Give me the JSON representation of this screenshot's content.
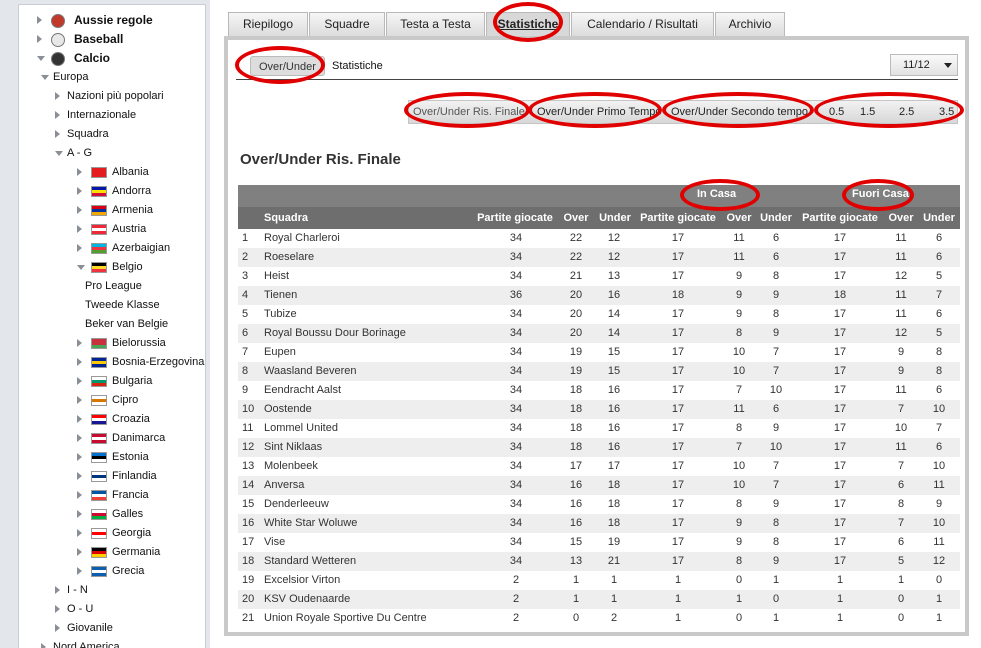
{
  "sidebar": {
    "items": [
      {
        "label": "Aussie regole",
        "kind": "sport",
        "icon": "rugby-ball-icon",
        "level": 0
      },
      {
        "label": "Baseball",
        "kind": "sport",
        "icon": "baseball-icon",
        "level": 0
      },
      {
        "label": "Calcio",
        "kind": "sport",
        "icon": "soccer-ball-icon",
        "level": 0,
        "expanded": true
      },
      {
        "label": "Europa",
        "level": 1,
        "expanded": true
      },
      {
        "label": "Nazioni più popolari",
        "level": 2
      },
      {
        "label": "Internazionale",
        "level": 2
      },
      {
        "label": "Squadra",
        "level": 2
      },
      {
        "label": "A - G",
        "level": 2,
        "expanded": true
      },
      {
        "label": "Albania",
        "level": 3,
        "flag": [
          "#e41e20",
          "#e41e20",
          "#e41e20"
        ]
      },
      {
        "label": "Andorra",
        "level": 3,
        "flag": [
          "#0018a8",
          "#fedf00",
          "#d0103a"
        ]
      },
      {
        "label": "Armenia",
        "level": 3,
        "flag": [
          "#d90012",
          "#0033a0",
          "#f2a800"
        ]
      },
      {
        "label": "Austria",
        "level": 3,
        "flag": [
          "#ed2939",
          "#ffffff",
          "#ed2939"
        ]
      },
      {
        "label": "Azerbaigian",
        "level": 3,
        "flag": [
          "#00b5e2",
          "#ef3340",
          "#509e2f"
        ]
      },
      {
        "label": "Belgio",
        "level": 3,
        "expanded": true,
        "flag": [
          "#000000",
          "#fdda24",
          "#ef3340"
        ]
      },
      {
        "label": "Pro League",
        "level": 4
      },
      {
        "label": "Tweede Klasse",
        "level": 4
      },
      {
        "label": "Beker van Belgie",
        "level": 4
      },
      {
        "label": "Bielorussia",
        "level": 3,
        "flag": [
          "#c8313e",
          "#c8313e",
          "#4aa657"
        ]
      },
      {
        "label": "Bosnia-Erzegovina",
        "level": 3,
        "flag": [
          "#002395",
          "#fecb00",
          "#002395"
        ]
      },
      {
        "label": "Bulgaria",
        "level": 3,
        "flag": [
          "#ffffff",
          "#00966e",
          "#d62612"
        ]
      },
      {
        "label": "Cipro",
        "level": 3,
        "flag": [
          "#ffffff",
          "#d57800",
          "#ffffff"
        ]
      },
      {
        "label": "Croazia",
        "level": 3,
        "flag": [
          "#ff0000",
          "#ffffff",
          "#171796"
        ]
      },
      {
        "label": "Danimarca",
        "level": 3,
        "flag": [
          "#c60c30",
          "#ffffff",
          "#c60c30"
        ]
      },
      {
        "label": "Estonia",
        "level": 3,
        "flag": [
          "#0072ce",
          "#000000",
          "#ffffff"
        ]
      },
      {
        "label": "Finlandia",
        "level": 3,
        "flag": [
          "#ffffff",
          "#003580",
          "#ffffff"
        ]
      },
      {
        "label": "Francia",
        "level": 3,
        "flag": [
          "#0055a4",
          "#ffffff",
          "#ef4135"
        ]
      },
      {
        "label": "Galles",
        "level": 3,
        "flag": [
          "#ffffff",
          "#d30731",
          "#00b140"
        ]
      },
      {
        "label": "Georgia",
        "level": 3,
        "flag": [
          "#ffffff",
          "#ff0000",
          "#ffffff"
        ]
      },
      {
        "label": "Germania",
        "level": 3,
        "flag": [
          "#000000",
          "#dd0000",
          "#ffce00"
        ]
      },
      {
        "label": "Grecia",
        "level": 3,
        "flag": [
          "#0d5eaf",
          "#ffffff",
          "#0d5eaf"
        ]
      },
      {
        "label": "I - N",
        "level": 2
      },
      {
        "label": "O - U",
        "level": 2
      },
      {
        "label": "Giovanile",
        "level": 2
      },
      {
        "label": "Nord America",
        "level": 1
      }
    ]
  },
  "tabs": [
    {
      "label": "Riepilogo"
    },
    {
      "label": "Squadre"
    },
    {
      "label": "Testa a Testa"
    },
    {
      "label": "Statistiche",
      "active": true
    },
    {
      "label": "Calendario / Risultati"
    },
    {
      "label": "Archivio"
    }
  ],
  "subbar": {
    "button": "Over/Under",
    "label": "Statistiche",
    "season": "11/12"
  },
  "filters": [
    "Over/Under Ris. Finale",
    "Over/Under Primo Tempo",
    "Over/Under Secondo tempo",
    "0.5",
    "1.5",
    "2.5",
    "3.5"
  ],
  "section_title": "Over/Under Ris. Finale",
  "table": {
    "group_home": "In Casa",
    "group_away": "Fuori Casa",
    "headers": [
      "Squadra",
      "Partite giocate",
      "Over",
      "Under",
      "Partite giocate",
      "Over",
      "Under",
      "Partite giocate",
      "Over",
      "Under"
    ],
    "rows": [
      [
        "1",
        "Royal Charleroi",
        "34",
        "22",
        "12",
        "17",
        "11",
        "6",
        "17",
        "11",
        "6"
      ],
      [
        "2",
        "Roeselare",
        "34",
        "22",
        "12",
        "17",
        "11",
        "6",
        "17",
        "11",
        "6"
      ],
      [
        "3",
        "Heist",
        "34",
        "21",
        "13",
        "17",
        "9",
        "8",
        "17",
        "12",
        "5"
      ],
      [
        "4",
        "Tienen",
        "36",
        "20",
        "16",
        "18",
        "9",
        "9",
        "18",
        "11",
        "7"
      ],
      [
        "5",
        "Tubize",
        "34",
        "20",
        "14",
        "17",
        "9",
        "8",
        "17",
        "11",
        "6"
      ],
      [
        "6",
        "Royal Boussu Dour Borinage",
        "34",
        "20",
        "14",
        "17",
        "8",
        "9",
        "17",
        "12",
        "5"
      ],
      [
        "7",
        "Eupen",
        "34",
        "19",
        "15",
        "17",
        "10",
        "7",
        "17",
        "9",
        "8"
      ],
      [
        "8",
        "Waasland Beveren",
        "34",
        "19",
        "15",
        "17",
        "10",
        "7",
        "17",
        "9",
        "8"
      ],
      [
        "9",
        "Eendracht Aalst",
        "34",
        "18",
        "16",
        "17",
        "7",
        "10",
        "17",
        "11",
        "6"
      ],
      [
        "10",
        "Oostende",
        "34",
        "18",
        "16",
        "17",
        "11",
        "6",
        "17",
        "7",
        "10"
      ],
      [
        "11",
        "Lommel United",
        "34",
        "18",
        "16",
        "17",
        "8",
        "9",
        "17",
        "10",
        "7"
      ],
      [
        "12",
        "Sint Niklaas",
        "34",
        "18",
        "16",
        "17",
        "7",
        "10",
        "17",
        "11",
        "6"
      ],
      [
        "13",
        "Molenbeek",
        "34",
        "17",
        "17",
        "17",
        "10",
        "7",
        "17",
        "7",
        "10"
      ],
      [
        "14",
        "Anversa",
        "34",
        "16",
        "18",
        "17",
        "10",
        "7",
        "17",
        "6",
        "11"
      ],
      [
        "15",
        "Denderleeuw",
        "34",
        "16",
        "18",
        "17",
        "8",
        "9",
        "17",
        "8",
        "9"
      ],
      [
        "16",
        "White Star Woluwe",
        "34",
        "16",
        "18",
        "17",
        "9",
        "8",
        "17",
        "7",
        "10"
      ],
      [
        "17",
        "Vise",
        "34",
        "15",
        "19",
        "17",
        "9",
        "8",
        "17",
        "6",
        "11"
      ],
      [
        "18",
        "Standard Wetteren",
        "34",
        "13",
        "21",
        "17",
        "8",
        "9",
        "17",
        "5",
        "12"
      ],
      [
        "19",
        "Excelsior Virton",
        "2",
        "1",
        "1",
        "1",
        "0",
        "1",
        "1",
        "1",
        "0"
      ],
      [
        "20",
        "KSV Oudenaarde",
        "2",
        "1",
        "1",
        "1",
        "1",
        "0",
        "1",
        "0",
        "1"
      ],
      [
        "21",
        "Union Royale Sportive Du Centre",
        "2",
        "0",
        "2",
        "1",
        "0",
        "1",
        "1",
        "0",
        "1"
      ]
    ]
  }
}
